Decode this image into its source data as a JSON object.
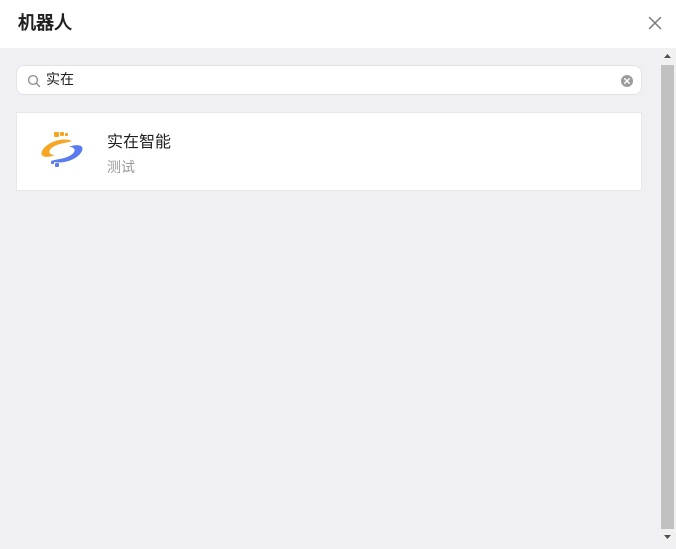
{
  "header": {
    "title": "机器人",
    "close_icon": "close-icon"
  },
  "search": {
    "value": "实在",
    "icon": "search-icon",
    "clear_icon": "clear-circle-icon"
  },
  "results": [
    {
      "name": "实在智能",
      "description": "测试",
      "logo": "robot-logo-icon"
    }
  ],
  "colors": {
    "header_bg": "#ffffff",
    "page_bg": "#f0f0f4",
    "card_bg": "#ffffff",
    "logo_orange": "#f5a623",
    "logo_blue": "#5b7cf0",
    "scroll_thumb": "#c1c1c1"
  }
}
